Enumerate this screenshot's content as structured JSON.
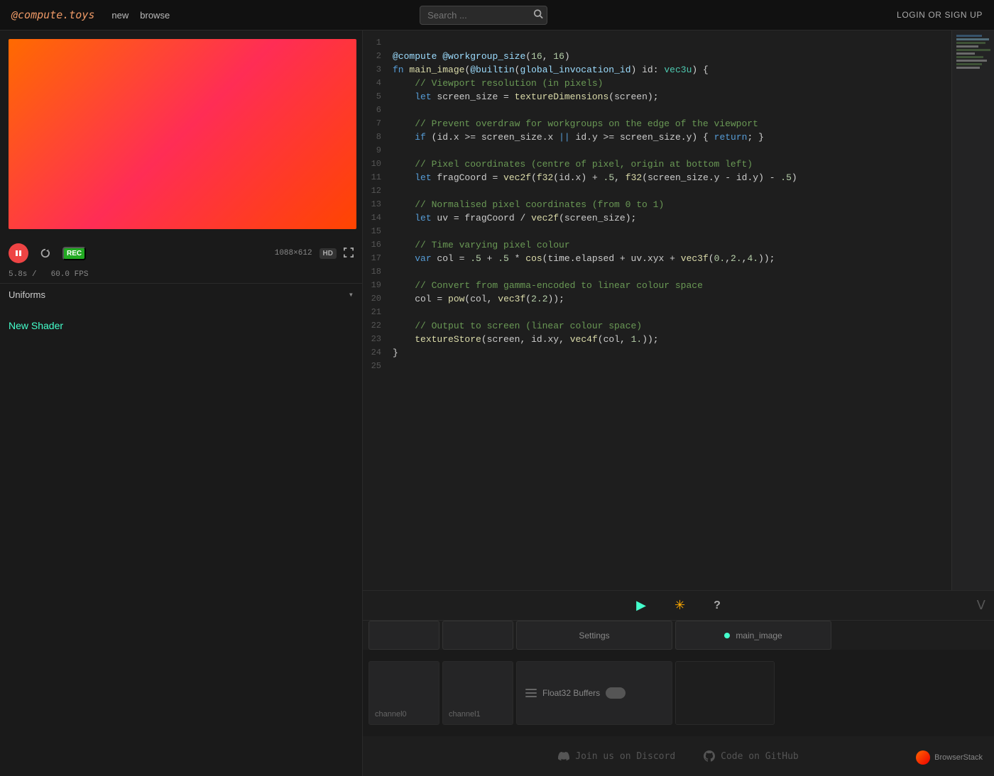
{
  "nav": {
    "logo_prefix": "@compute.",
    "logo_suffix": "toys",
    "links": [
      "new",
      "browse"
    ],
    "search_placeholder": "Search ...",
    "auth_label": "LOGIN OR SIGN UP"
  },
  "preview": {
    "time": "5.8s /",
    "fps": "60.0 FPS",
    "resolution": "1088×612",
    "hd_label": "HD",
    "pause_label": "⏸",
    "restart_label": "↺",
    "rec_label": "REC",
    "fullscreen_label": "⛶"
  },
  "uniforms": {
    "label": "Uniforms",
    "chevron": "▾"
  },
  "new_shader": {
    "label": "New Shader"
  },
  "editor": {
    "lines": [
      {
        "num": 1,
        "tokens": []
      },
      {
        "num": 2,
        "raw": "@compute @workgroup_size(16, 16)"
      },
      {
        "num": 3,
        "raw": "fn main_image(@builtin(global_invocation_id) id: vec3u) {"
      },
      {
        "num": 4,
        "raw": "    // Viewport resolution (in pixels)"
      },
      {
        "num": 5,
        "raw": "    let screen_size = textureDimensions(screen);"
      },
      {
        "num": 6,
        "raw": ""
      },
      {
        "num": 7,
        "raw": "    // Prevent overdraw for workgroups on the edge of the viewport"
      },
      {
        "num": 8,
        "raw": "    if (id.x >= screen_size.x || id.y >= screen_size.y) { return; }"
      },
      {
        "num": 9,
        "raw": ""
      },
      {
        "num": 10,
        "raw": "    // Pixel coordinates (centre of pixel, origin at bottom left)"
      },
      {
        "num": 11,
        "raw": "    let fragCoord = vec2f(f32(id.x) + .5, f32(screen_size.y - id.y) - .5)"
      },
      {
        "num": 12,
        "raw": ""
      },
      {
        "num": 13,
        "raw": "    // Normalised pixel coordinates (from 0 to 1)"
      },
      {
        "num": 14,
        "raw": "    let uv = fragCoord / vec2f(screen_size);"
      },
      {
        "num": 15,
        "raw": ""
      },
      {
        "num": 16,
        "raw": "    // Time varying pixel colour"
      },
      {
        "num": 17,
        "raw": "    var col = .5 + .5 * cos(time.elapsed + uv.xyx + vec3f(0.,2.,4.));"
      },
      {
        "num": 18,
        "raw": ""
      },
      {
        "num": 19,
        "raw": "    // Convert from gamma-encoded to linear colour space"
      },
      {
        "num": 20,
        "raw": "    col = pow(col, vec3f(2.2));"
      },
      {
        "num": 21,
        "raw": ""
      },
      {
        "num": 22,
        "raw": "    // Output to screen (linear colour space)"
      },
      {
        "num": 23,
        "raw": "    textureStore(screen, id.xy, vec4f(col, 1.));"
      },
      {
        "num": 24,
        "raw": "}"
      },
      {
        "num": 25,
        "raw": ""
      }
    ],
    "footer": {
      "play": "▶",
      "compile": "✳",
      "help": "?"
    }
  },
  "tabs": {
    "tab1_label": "",
    "tab2_label": "",
    "settings_label": "Settings",
    "main_image_label": "main_image"
  },
  "channels": {
    "channel0_label": "channel0",
    "channel1_label": "channel1",
    "float32_label": "Float32 Buffers"
  },
  "footer": {
    "discord_label": "Join us on Discord",
    "github_label": "Code on GitHub"
  },
  "browserstack": {
    "label": "BrowserStack"
  }
}
